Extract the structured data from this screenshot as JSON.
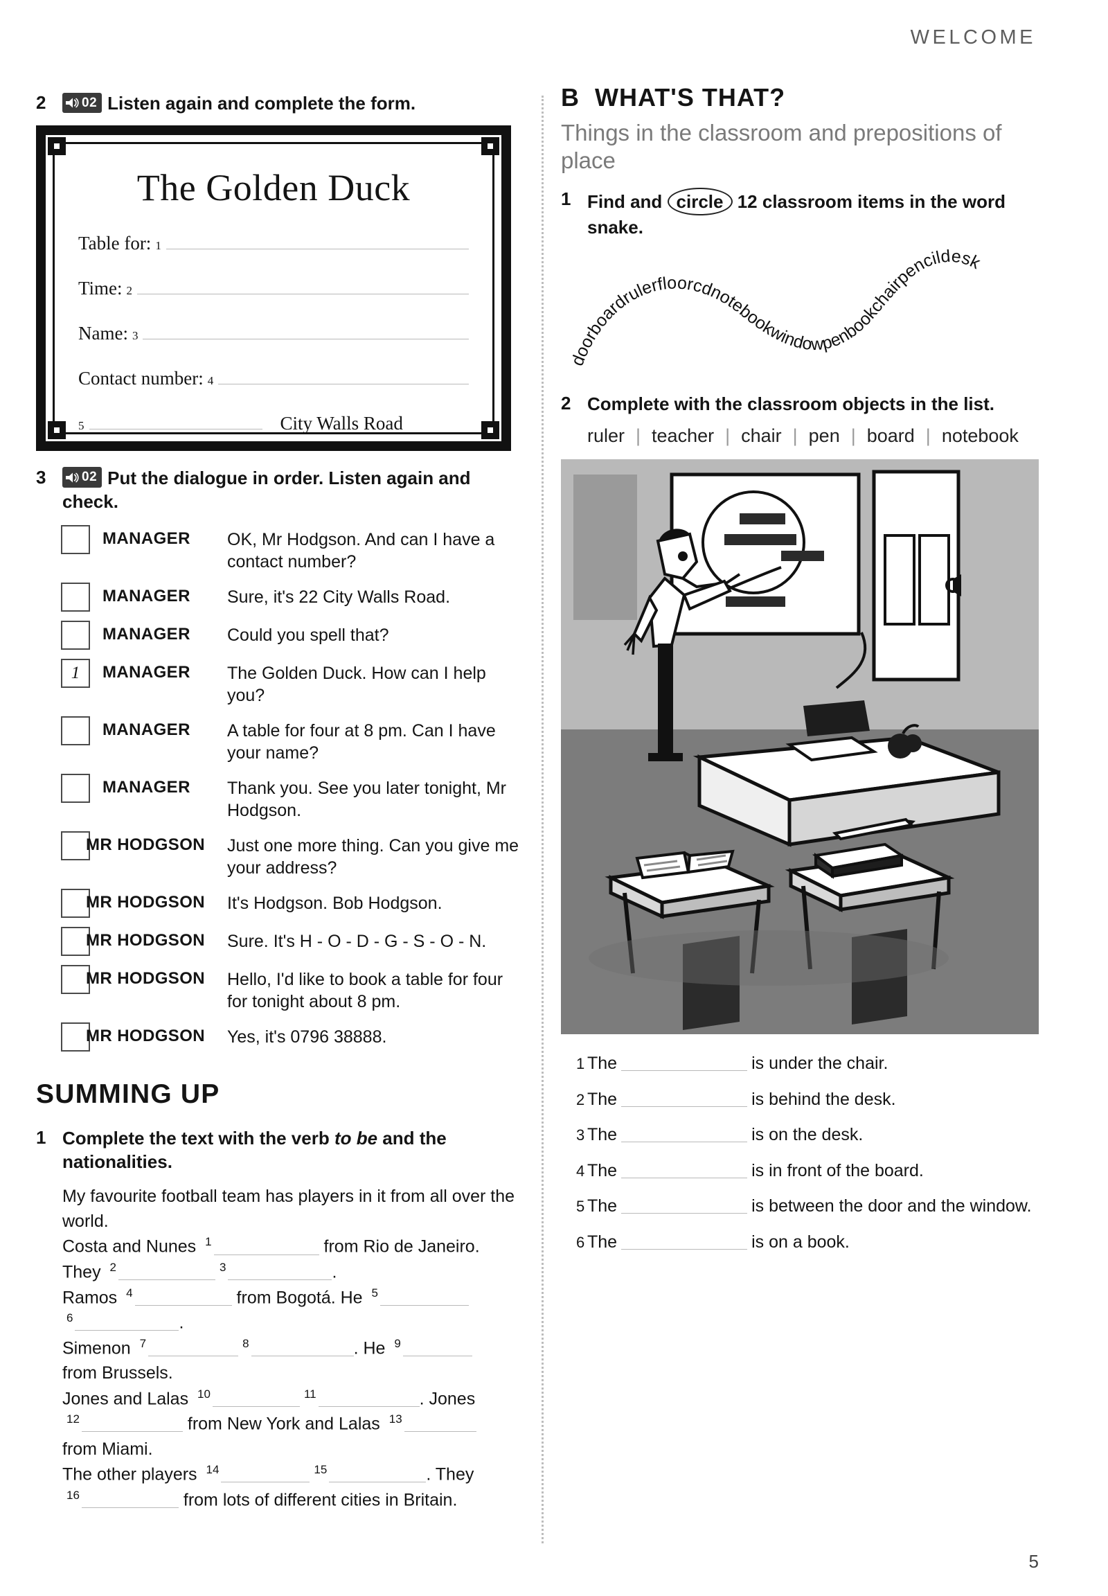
{
  "page": {
    "running_head": "WELCOME",
    "folio": "5"
  },
  "left": {
    "ex2": {
      "number": "2",
      "audio_track": "02",
      "instruction": "Listen again and complete the form."
    },
    "form": {
      "title": "The Golden Duck",
      "rows": [
        {
          "label": "Table for:",
          "sup": "1"
        },
        {
          "label": "Time:",
          "sup": "2"
        },
        {
          "label": "Name:",
          "sup": "3"
        },
        {
          "label": "Contact number:",
          "sup": "4"
        }
      ],
      "address": {
        "sup": "5",
        "text": "City Walls Road"
      }
    },
    "ex3": {
      "number": "3",
      "audio_track": "02",
      "instruction": "Put the dialogue in order. Listen again and check.",
      "lines": [
        {
          "order": "",
          "speaker": "MANAGER",
          "text": "OK, Mr Hodgson. And can I have a contact number?"
        },
        {
          "order": "",
          "speaker": "MANAGER",
          "text": "Sure, it's 22 City Walls Road."
        },
        {
          "order": "",
          "speaker": "MANAGER",
          "text": "Could you spell that?"
        },
        {
          "order": "1",
          "speaker": "MANAGER",
          "text": "The Golden Duck. How can I help you?"
        },
        {
          "order": "",
          "speaker": "MANAGER",
          "text": "A table for four at 8 pm. Can I have your name?"
        },
        {
          "order": "",
          "speaker": "MANAGER",
          "text": "Thank you. See you later tonight, Mr Hodgson."
        },
        {
          "order": "",
          "speaker": "MR HODGSON",
          "text": "Just one more thing. Can you give me your address?"
        },
        {
          "order": "",
          "speaker": "MR HODGSON",
          "text": "It's Hodgson. Bob Hodgson."
        },
        {
          "order": "",
          "speaker": "MR HODGSON",
          "text": "Sure. It's H - O - D - G - S - O - N."
        },
        {
          "order": "",
          "speaker": "MR HODGSON",
          "text": "Hello, I'd like to book a table for four for tonight about 8 pm."
        },
        {
          "order": "",
          "speaker": "MR HODGSON",
          "text": "Yes, it's 0796 38888."
        }
      ]
    },
    "summing_up": {
      "title": "SUMMING UP",
      "ex1_number": "1",
      "ex1_instruction_a": "Complete the text with the verb ",
      "ex1_instruction_italic": "to be",
      "ex1_instruction_b": " and the nationalities.",
      "text_intro": "My favourite football team has players in it from all over the world.",
      "gap_text": [
        {
          "before": "Costa and Nunes ",
          "sup": "1",
          "after": " from Rio de Janeiro."
        },
        {
          "before": "They ",
          "sup": "2",
          "after": ""
        },
        {
          "before": "",
          "sup": "3",
          "after": "."
        },
        {
          "before": "Ramos ",
          "sup": "4",
          "after": " from Bogotá. He "
        },
        {
          "before": "",
          "sup": "5",
          "after": ""
        },
        {
          "before": "",
          "sup": "6",
          "after": "."
        },
        {
          "before": "Simenon ",
          "sup": "7",
          "after": ""
        },
        {
          "before": "",
          "sup": "8",
          "after": ". He "
        },
        {
          "before": "",
          "sup": "9",
          "after": ""
        },
        {
          "before": "from Brussels.",
          "sup": "",
          "after": ""
        },
        {
          "before": "Jones and Lalas ",
          "sup": "10",
          "after": ""
        },
        {
          "before": "",
          "sup": "11",
          "after": ". Jones"
        },
        {
          "before": "",
          "sup": "12",
          "after": " from New York and Lalas "
        },
        {
          "before": "",
          "sup": "13",
          "after": ""
        },
        {
          "before": "from Miami.",
          "sup": "",
          "after": ""
        },
        {
          "before": "The other players ",
          "sup": "14",
          "after": ""
        },
        {
          "before": "",
          "sup": "15",
          "after": ". They"
        },
        {
          "before": "",
          "sup": "16",
          "after": " from lots of different cities in Britain."
        }
      ]
    }
  },
  "right": {
    "section": {
      "letter": "B",
      "title": "WHAT'S THAT?",
      "subtitle": "Things in the classroom and prepositions of place"
    },
    "ex1": {
      "number": "1",
      "instruction_before": "Find and ",
      "instruction_circled": "circle",
      "instruction_after": " 12 classroom items in the word snake.",
      "snake_words": [
        "door",
        "board",
        "ruler",
        "floor",
        "cd",
        "notebook",
        "window",
        "pen",
        "book",
        "chair",
        "pencil",
        "desk"
      ],
      "snake_text": "doorboardrulerfloorcdnotebookwindowpenbookchairpencildesk"
    },
    "ex2": {
      "number": "2",
      "instruction": "Complete with the classroom objects in the list.",
      "wordbank": [
        "ruler",
        "teacher",
        "chair",
        "pen",
        "board",
        "notebook"
      ],
      "questions": [
        {
          "num": "1",
          "before": "The",
          "after": "is under the chair."
        },
        {
          "num": "2",
          "before": "The",
          "after": "is behind the desk."
        },
        {
          "num": "3",
          "before": "The",
          "after": "is on the desk."
        },
        {
          "num": "4",
          "before": "The",
          "after": "is in front of the board."
        },
        {
          "num": "5",
          "before": "The",
          "after": "is between the door and the window."
        },
        {
          "num": "6",
          "before": "The",
          "after": "is on a book."
        }
      ]
    },
    "illustration": {
      "caption": "classroom scene with teacher pointing at board, desk, chair, books and pencils"
    }
  }
}
